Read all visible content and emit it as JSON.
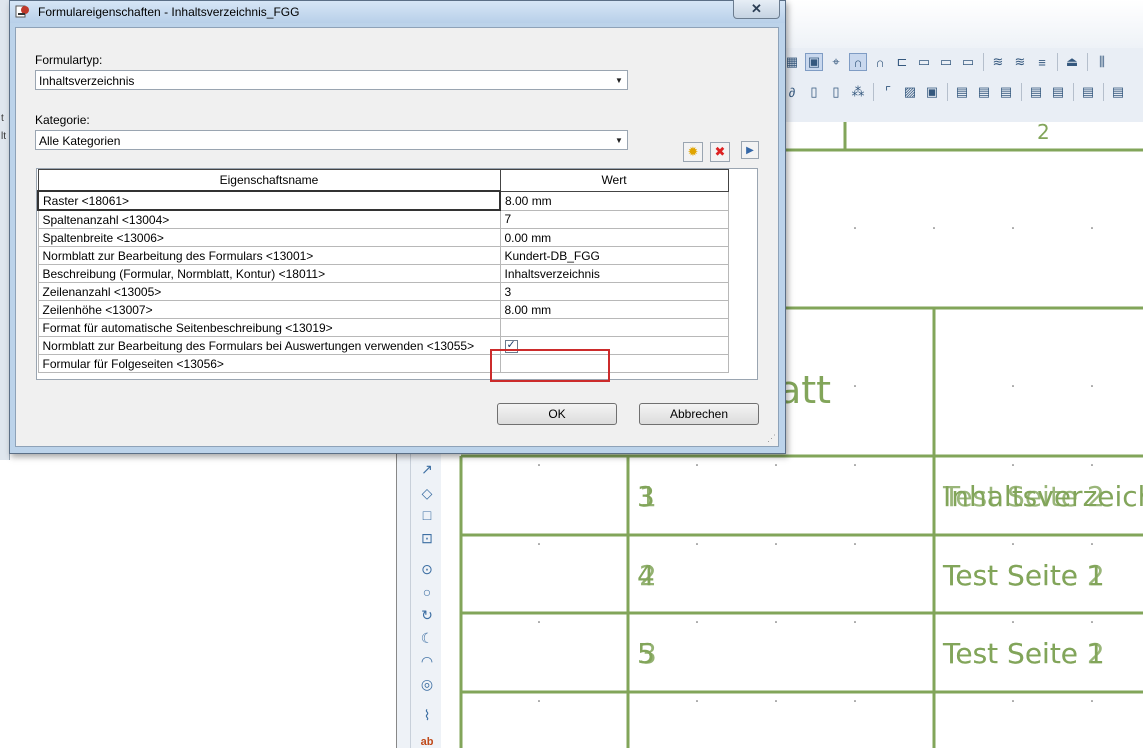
{
  "dialog": {
    "title": "Formulareigenschaften - Inhaltsverzeichnis_FGG",
    "close_symbol": "✕",
    "formulartyp_label": "Formulartyp:",
    "formulartyp_value": "Inhaltsverzeichnis",
    "kategorie_label": "Kategorie:",
    "kategorie_value": "Alle Kategorien",
    "grid": {
      "headers": [
        "Eigenschaftsname",
        "Wert"
      ],
      "rows": [
        {
          "name": "Raster <18061>",
          "value": "8.00 mm"
        },
        {
          "name": "Spaltenanzahl <13004>",
          "value": "7"
        },
        {
          "name": "Spaltenbreite <13006>",
          "value": "0.00 mm"
        },
        {
          "name": "Normblatt zur Bearbeitung des Formulars <13001>",
          "value": "Kundert-DB_FGG"
        },
        {
          "name": "Beschreibung (Formular, Normblatt, Kontur) <18011>",
          "value": "Inhaltsverzeichnis"
        },
        {
          "name": "Zeilenanzahl <13005>",
          "value": "3"
        },
        {
          "name": "Zeilenhöhe <13007>",
          "value": "8.00 mm"
        },
        {
          "name": "Format für automatische Seitenbeschreibung <13019>",
          "value": ""
        },
        {
          "name": "Normblatt zur Bearbeitung des Formulars bei Auswertungen verwenden <13055>",
          "value": "",
          "checkbox": true,
          "checked": true
        },
        {
          "name": "Formular für Folgeseiten <13056>",
          "value": ""
        }
      ]
    },
    "ok_label": "OK",
    "cancel_label": "Abbrechen"
  },
  "canvas": {
    "header_number": "2",
    "partial_title": "att",
    "rows": [
      {
        "number_a": "3",
        "number_b": "1",
        "text": "Inhaltsverzeichnis",
        "text_b": "Test Seite 2"
      },
      {
        "number_a": "4",
        "number_b": "2",
        "text": "Test Seite 1",
        "text_b": "Test Seite 2"
      },
      {
        "number_a": "5",
        "number_b": "3",
        "text": "Test Seite 1",
        "text_b": "Test Seite 2"
      }
    ],
    "line_color": "#82a55a"
  },
  "toolbar_bottom_label": "ab",
  "left_strip_chars": [
    "t",
    "lt"
  ]
}
